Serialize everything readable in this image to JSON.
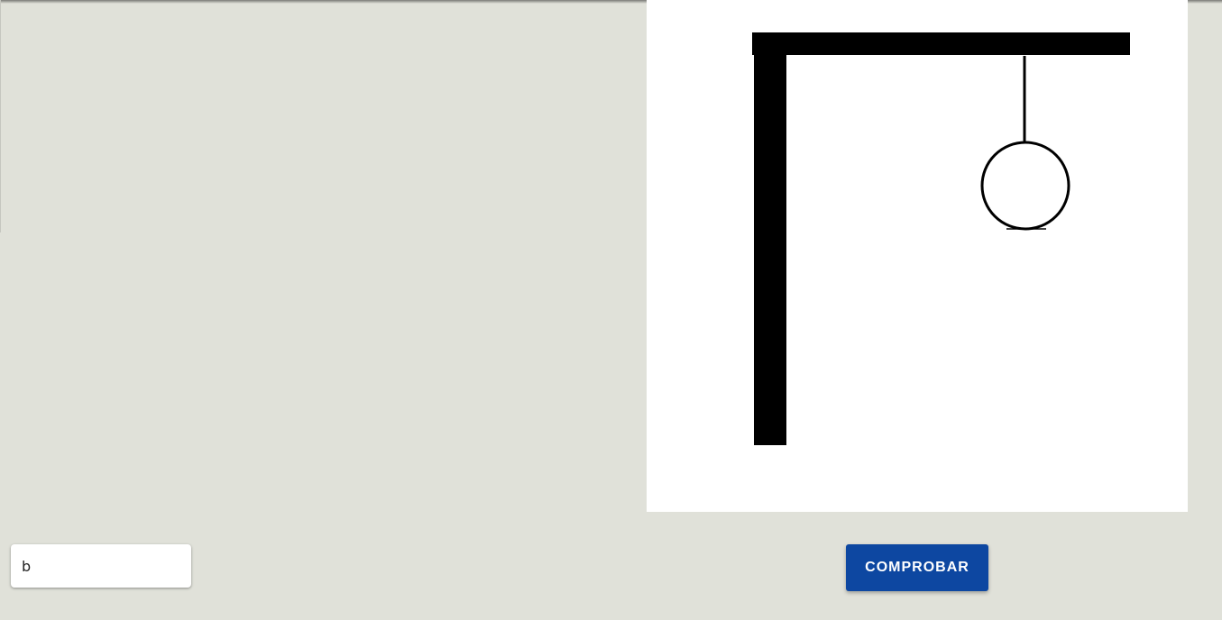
{
  "game": {
    "guess_input": {
      "value": "b",
      "placeholder": ""
    },
    "check_button": {
      "label": "COMPROBAR"
    },
    "hangman": {
      "parts_drawn": [
        "gallows-post",
        "gallows-beam",
        "rope",
        "head"
      ],
      "color": "#000000"
    }
  },
  "colors": {
    "background": "#e0e1d9",
    "panel": "#ffffff",
    "button": "#0d47a1",
    "button_text": "#ffffff"
  }
}
